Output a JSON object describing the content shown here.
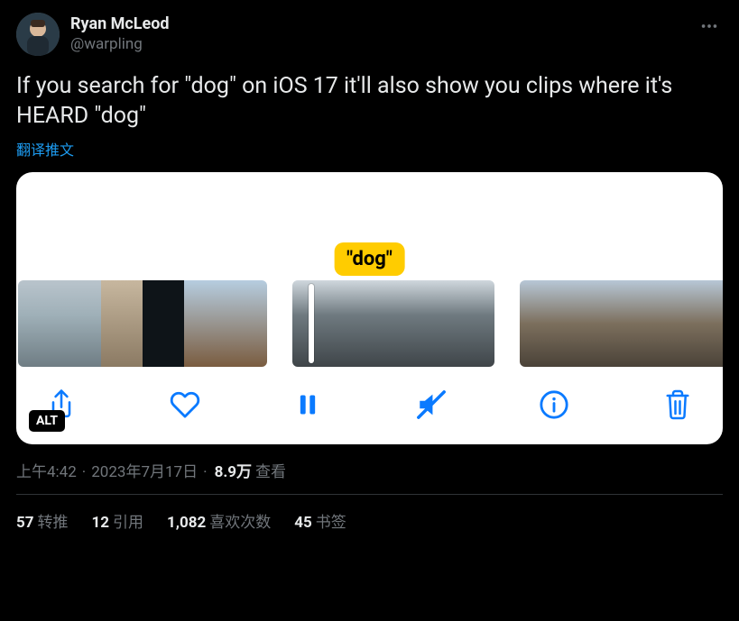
{
  "author": {
    "display_name": "Ryan McLeod",
    "handle": "@warpling"
  },
  "tweet_text": "If you search for \"dog\" on iOS 17 it'll also show you clips where it's HEARD \"dog\"",
  "translate_label": "翻译推文",
  "media": {
    "search_bubble": "\"dog\"",
    "alt_badge": "ALT",
    "toolbar": {
      "share": "share",
      "like": "like",
      "pause": "pause",
      "mute": "mute",
      "info": "info",
      "delete": "delete"
    }
  },
  "meta": {
    "time": "上午4:42",
    "date": "2023年7月17日",
    "views_number": "8.9万",
    "views_label": "查看"
  },
  "stats": {
    "retweets_num": "57",
    "retweets_label": "转推",
    "quotes_num": "12",
    "quotes_label": "引用",
    "likes_num": "1,082",
    "likes_label": "喜欢次数",
    "bookmarks_num": "45",
    "bookmarks_label": "书签"
  }
}
